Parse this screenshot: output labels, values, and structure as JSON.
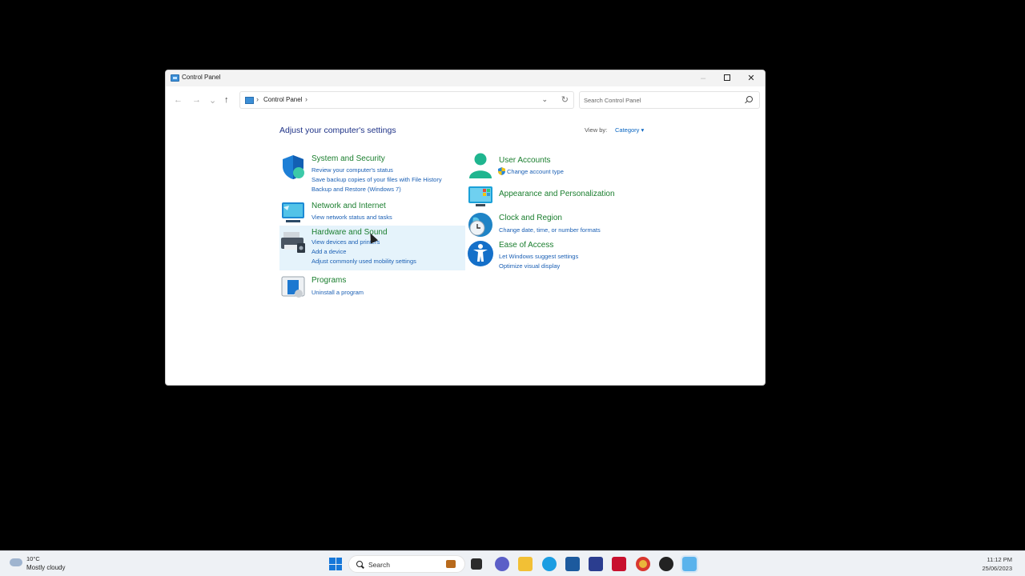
{
  "window": {
    "title": "Control Panel",
    "controls": {
      "minimize": "–",
      "close": "✕"
    }
  },
  "nav": {
    "back": "←",
    "forward": "→",
    "recent": "⌄",
    "up": "↑",
    "breadcrumb": "Control Panel",
    "separator": "›",
    "dropdown": "⌄",
    "refresh": "↻",
    "search_placeholder": "Search Control Panel"
  },
  "content": {
    "heading": "Adjust your computer's settings",
    "view_by_label": "View by:",
    "view_by_value": "Category ▾"
  },
  "categories": {
    "system": {
      "title": "System and Security",
      "links": [
        "Review your computer's status",
        "Save backup copies of your files with File History",
        "Backup and Restore (Windows 7)"
      ]
    },
    "network": {
      "title": "Network and Internet",
      "links": [
        "View network status and tasks"
      ]
    },
    "hardware": {
      "title": "Hardware and Sound",
      "links": [
        "View devices and printers",
        "Add a device",
        "Adjust commonly used mobility settings"
      ]
    },
    "programs": {
      "title": "Programs",
      "links": [
        "Uninstall a program"
      ]
    },
    "users": {
      "title": "User Accounts",
      "links": [
        "Change account type"
      ]
    },
    "appearance": {
      "title": "Appearance and Personalization",
      "links": []
    },
    "clock": {
      "title": "Clock and Region",
      "links": [
        "Change date, time, or number formats"
      ]
    },
    "ease": {
      "title": "Ease of Access",
      "links": [
        "Let Windows suggest settings",
        "Optimize visual display"
      ]
    }
  },
  "taskbar": {
    "weather_temp": "10°C",
    "weather_desc": "Mostly cloudy",
    "search_label": "Search",
    "time": "11:12 PM",
    "date": "25/06/2023"
  }
}
